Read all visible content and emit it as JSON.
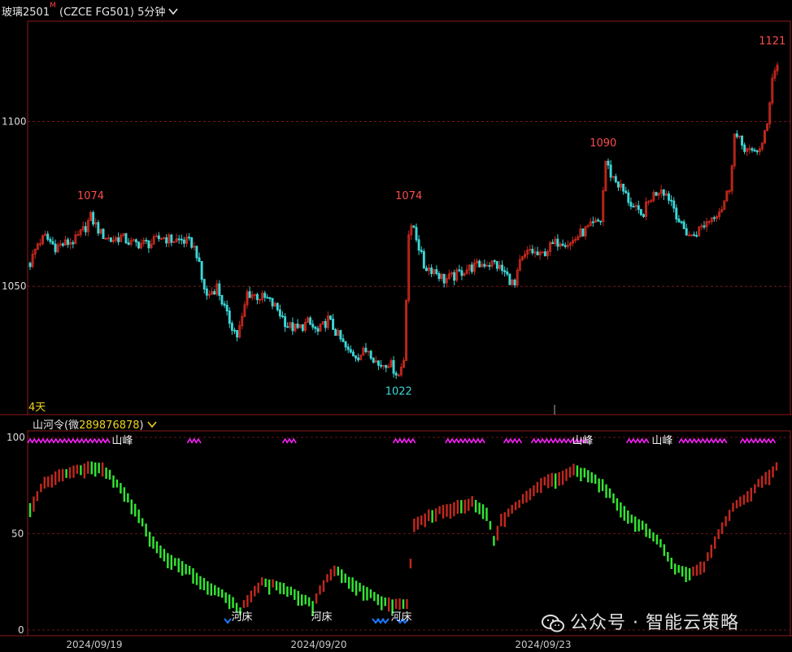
{
  "header": {
    "symbol": "玻璃2501",
    "superscript": "M",
    "contract": "(CZCE FG501)",
    "period": "5分钟",
    "dropdown_icon": "chevron-down-icon"
  },
  "colors": {
    "up": "#c8281e",
    "down": "#3dd6d6",
    "grid": "#8b1a1a",
    "border": "#8b1a1a",
    "high_label": "#ff4b4b",
    "low_label": "#3dd6d6",
    "indicator_up": "#c0281e",
    "indicator_down": "#32e632",
    "peak_marker": "#ff20ff",
    "bed_marker": "#1e78ff",
    "accent_yellow": "#f0d21e"
  },
  "days_label": "4天",
  "indicator": {
    "title": "山河令",
    "account_prefix": "(微",
    "account_number": "289876878",
    "account_suffix": ")",
    "peak_label": "山峰",
    "bed_label": "河床"
  },
  "watermark": {
    "text": "公众号 · 智能云策略",
    "icon": "wechat-icon"
  },
  "chart_data": [
    {
      "type": "candlestick",
      "title": "玻璃2501 (CZCE FG501) 5分钟",
      "y_ticks": [
        1050,
        1100
      ],
      "ylim": [
        1017,
        1126
      ],
      "grid": true,
      "annotations": [
        {
          "text": "1074",
          "kind": "high",
          "x_index": 24,
          "value": 1074
        },
        {
          "text": "1074",
          "kind": "high",
          "x_index": 150,
          "value": 1074
        },
        {
          "text": "1022",
          "kind": "low",
          "x_index": 146,
          "value": 1022
        },
        {
          "text": "1090",
          "kind": "high",
          "x_index": 227,
          "value": 1090
        },
        {
          "text": "1121",
          "kind": "high",
          "x_index": 294,
          "value": 1121
        }
      ],
      "x_date_ticks": [
        {
          "label": "2024/09/19",
          "x_index": 15
        },
        {
          "label": "2024/09/20",
          "x_index": 100
        },
        {
          "label": "2024/09/23",
          "x_index": 184
        }
      ],
      "close_anchors": [
        [
          0,
          1057
        ],
        [
          3,
          1063
        ],
        [
          6,
          1065
        ],
        [
          10,
          1062
        ],
        [
          14,
          1063
        ],
        [
          18,
          1064
        ],
        [
          22,
          1068
        ],
        [
          24,
          1071
        ],
        [
          28,
          1066
        ],
        [
          32,
          1064
        ],
        [
          36,
          1065
        ],
        [
          40,
          1063
        ],
        [
          44,
          1063
        ],
        [
          48,
          1063
        ],
        [
          52,
          1065
        ],
        [
          56,
          1064
        ],
        [
          60,
          1064
        ],
        [
          64,
          1063
        ],
        [
          66,
          1060
        ],
        [
          68,
          1052
        ],
        [
          70,
          1047
        ],
        [
          74,
          1050
        ],
        [
          78,
          1041
        ],
        [
          82,
          1035
        ],
        [
          84,
          1040
        ],
        [
          86,
          1048
        ],
        [
          90,
          1047
        ],
        [
          94,
          1046
        ],
        [
          98,
          1043
        ],
        [
          102,
          1038
        ],
        [
          106,
          1037
        ],
        [
          110,
          1039
        ],
        [
          114,
          1036
        ],
        [
          118,
          1040
        ],
        [
          122,
          1035
        ],
        [
          126,
          1030
        ],
        [
          130,
          1029
        ],
        [
          134,
          1031
        ],
        [
          138,
          1026
        ],
        [
          142,
          1027
        ],
        [
          146,
          1023
        ],
        [
          148,
          1028
        ],
        [
          150,
          1066
        ],
        [
          152,
          1068
        ],
        [
          156,
          1056
        ],
        [
          160,
          1055
        ],
        [
          164,
          1052
        ],
        [
          168,
          1053
        ],
        [
          172,
          1055
        ],
        [
          176,
          1056
        ],
        [
          180,
          1057
        ],
        [
          184,
          1057
        ],
        [
          188,
          1054
        ],
        [
          192,
          1050
        ],
        [
          194,
          1057
        ],
        [
          198,
          1061
        ],
        [
          202,
          1059
        ],
        [
          206,
          1062
        ],
        [
          210,
          1064
        ],
        [
          214,
          1063
        ],
        [
          218,
          1066
        ],
        [
          222,
          1068
        ],
        [
          226,
          1070
        ],
        [
          228,
          1088
        ],
        [
          230,
          1084
        ],
        [
          234,
          1080
        ],
        [
          238,
          1075
        ],
        [
          242,
          1071
        ],
        [
          246,
          1077
        ],
        [
          250,
          1080
        ],
        [
          254,
          1076
        ],
        [
          258,
          1068
        ],
        [
          262,
          1065
        ],
        [
          266,
          1068
        ],
        [
          270,
          1071
        ],
        [
          274,
          1074
        ],
        [
          277,
          1080
        ],
        [
          279,
          1096
        ],
        [
          282,
          1093
        ],
        [
          286,
          1090
        ],
        [
          290,
          1093
        ],
        [
          292,
          1099
        ],
        [
          294,
          1114
        ],
        [
          296,
          1117
        ]
      ],
      "x_range": [
        0,
        296
      ]
    },
    {
      "type": "bar",
      "title": "山河令",
      "y_ticks": [
        0,
        50,
        100
      ],
      "ylim": [
        0,
        100
      ],
      "grid": true,
      "series": [
        {
          "name": "山河令",
          "anchors": [
            [
              0,
              66
            ],
            [
              4,
              79
            ],
            [
              8,
              83
            ],
            [
              12,
              85
            ],
            [
              16,
              87
            ],
            [
              20,
              87
            ],
            [
              26,
              74
            ],
            [
              30,
              62
            ],
            [
              34,
              48
            ],
            [
              38,
              40
            ],
            [
              42,
              36
            ],
            [
              46,
              30
            ],
            [
              50,
              24
            ],
            [
              54,
              20
            ],
            [
              56,
              17
            ],
            [
              58,
              12
            ],
            [
              60,
              18
            ],
            [
              64,
              27
            ],
            [
              68,
              26
            ],
            [
              72,
              22
            ],
            [
              76,
              18
            ],
            [
              78,
              15
            ],
            [
              80,
              23
            ],
            [
              84,
              34
            ],
            [
              88,
              28
            ],
            [
              92,
              23
            ],
            [
              96,
              19
            ],
            [
              98,
              17
            ],
            [
              100,
              16
            ],
            [
              102,
              17
            ],
            [
              104,
              16
            ],
            [
              106,
              58
            ],
            [
              110,
              62
            ],
            [
              114,
              65
            ],
            [
              118,
              67
            ],
            [
              122,
              69
            ],
            [
              126,
              64
            ],
            [
              128,
              49
            ],
            [
              130,
              60
            ],
            [
              134,
              66
            ],
            [
              138,
              74
            ],
            [
              142,
              80
            ],
            [
              146,
              82
            ],
            [
              150,
              86
            ],
            [
              154,
              83
            ],
            [
              158,
              78
            ],
            [
              162,
              68
            ],
            [
              166,
              60
            ],
            [
              170,
              55
            ],
            [
              174,
              47
            ],
            [
              178,
              35
            ],
            [
              182,
              32
            ],
            [
              186,
              36
            ],
            [
              190,
              52
            ],
            [
              194,
              66
            ],
            [
              198,
              72
            ],
            [
              202,
              80
            ],
            [
              206,
              87
            ]
          ]
        }
      ],
      "peak_markers": [
        {
          "label": "山峰",
          "x_index": 25
        },
        {
          "label": "山峰",
          "x_index": 152
        },
        {
          "label": "山峰",
          "x_index": 174
        }
      ],
      "bed_markers": [
        {
          "label": "河床",
          "x_index": 58
        },
        {
          "label": "河床",
          "x_index": 80
        },
        {
          "label": "河床",
          "x_index": 102
        }
      ]
    }
  ]
}
